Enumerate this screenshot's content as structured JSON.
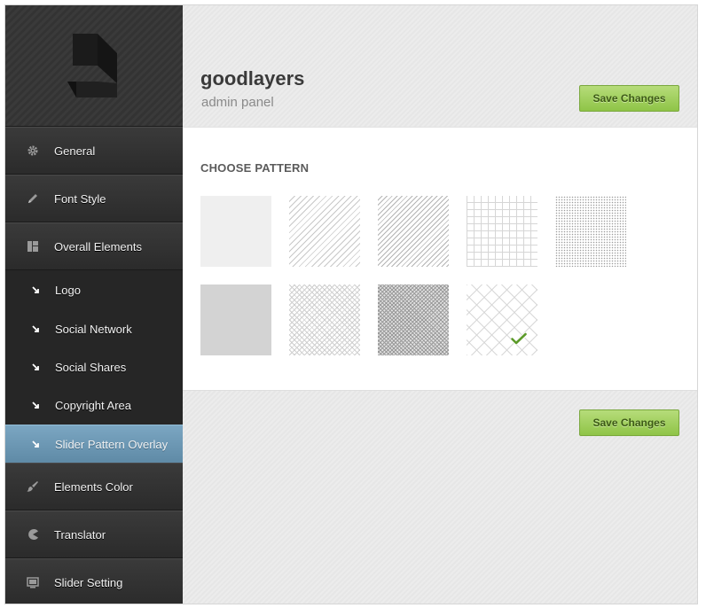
{
  "header": {
    "title": "goodlayers",
    "subtitle": "admin panel",
    "save_label": "Save Changes"
  },
  "sidebar": {
    "items": [
      {
        "label": "General",
        "icon": "gear-icon"
      },
      {
        "label": "Font Style",
        "icon": "pencil-icon"
      },
      {
        "label": "Overall Elements",
        "icon": "layout-icon"
      }
    ],
    "sub_items": [
      {
        "label": "Logo"
      },
      {
        "label": "Social Network"
      },
      {
        "label": "Social Shares"
      },
      {
        "label": "Copyright Area"
      },
      {
        "label": "Slider Pattern Overlay",
        "active": true
      }
    ],
    "items_after": [
      {
        "label": "Elements Color",
        "icon": "brush-icon"
      },
      {
        "label": "Translator",
        "icon": "pacman-icon"
      },
      {
        "label": "Slider Setting",
        "icon": "slides-icon"
      }
    ]
  },
  "panel": {
    "title": "CHOOSE PATTERN",
    "patterns": [
      {
        "id": 1,
        "selected": false
      },
      {
        "id": 2,
        "selected": false
      },
      {
        "id": 3,
        "selected": false
      },
      {
        "id": 4,
        "selected": false
      },
      {
        "id": 5,
        "selected": false
      },
      {
        "id": 6,
        "selected": false
      },
      {
        "id": 7,
        "selected": false
      },
      {
        "id": 8,
        "selected": false
      },
      {
        "id": 9,
        "selected": true
      }
    ]
  },
  "footer": {
    "save_label": "Save Changes"
  },
  "colors": {
    "active_nav": "#6e99b5",
    "save_button": "#a3d060",
    "sidebar_bg": "#2c2c2c"
  }
}
